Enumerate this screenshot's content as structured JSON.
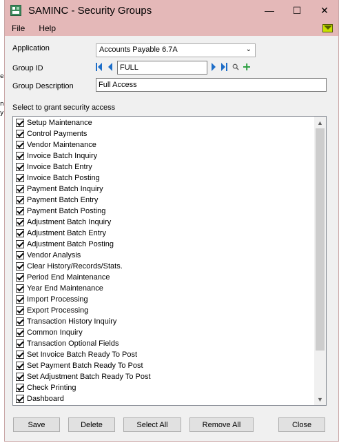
{
  "window": {
    "title": "SAMINC - Security Groups",
    "minimize": "—",
    "maximize": "☐",
    "close": "✕"
  },
  "menu": [
    {
      "label": "File"
    },
    {
      "label": "Help"
    }
  ],
  "form": {
    "application_label": "Application",
    "application_value": "Accounts Payable 6.7A",
    "group_id_label": "Group ID",
    "group_id_value": "FULL",
    "group_description_label": "Group Description",
    "group_description_value": "Full Access",
    "section_label": "Select to grant security access"
  },
  "permissions": [
    "Setup Maintenance",
    "Control Payments",
    "Vendor Maintenance",
    "Invoice Batch Inquiry",
    "Invoice Batch Entry",
    "Invoice Batch Posting",
    "Payment Batch Inquiry",
    "Payment Batch Entry",
    "Payment Batch Posting",
    "Adjustment Batch Inquiry",
    "Adjustment Batch Entry",
    "Adjustment Batch Posting",
    "Vendor Analysis",
    "Clear History/Records/Stats.",
    "Period End Maintenance",
    "Year End Maintenance",
    "Import Processing",
    "Export Processing",
    "Transaction History Inquiry",
    "Common Inquiry",
    "Transaction Optional Fields",
    "Set Invoice Batch Ready To Post",
    "Set Payment Batch Ready To Post",
    "Set Adjustment Batch Ready To Post",
    "Check Printing",
    "Dashboard"
  ],
  "buttons": {
    "save": "Save",
    "delete": "Delete",
    "select_all": "Select All",
    "remove_all": "Remove All",
    "close": "Close"
  },
  "background": {
    "frag1": "e",
    "frag2": "n",
    "frag3": "y"
  },
  "colors": {
    "titlebar": "#e4b8b8",
    "add_icon": "#2ea043",
    "nav_icon": "#1e6ec8"
  }
}
